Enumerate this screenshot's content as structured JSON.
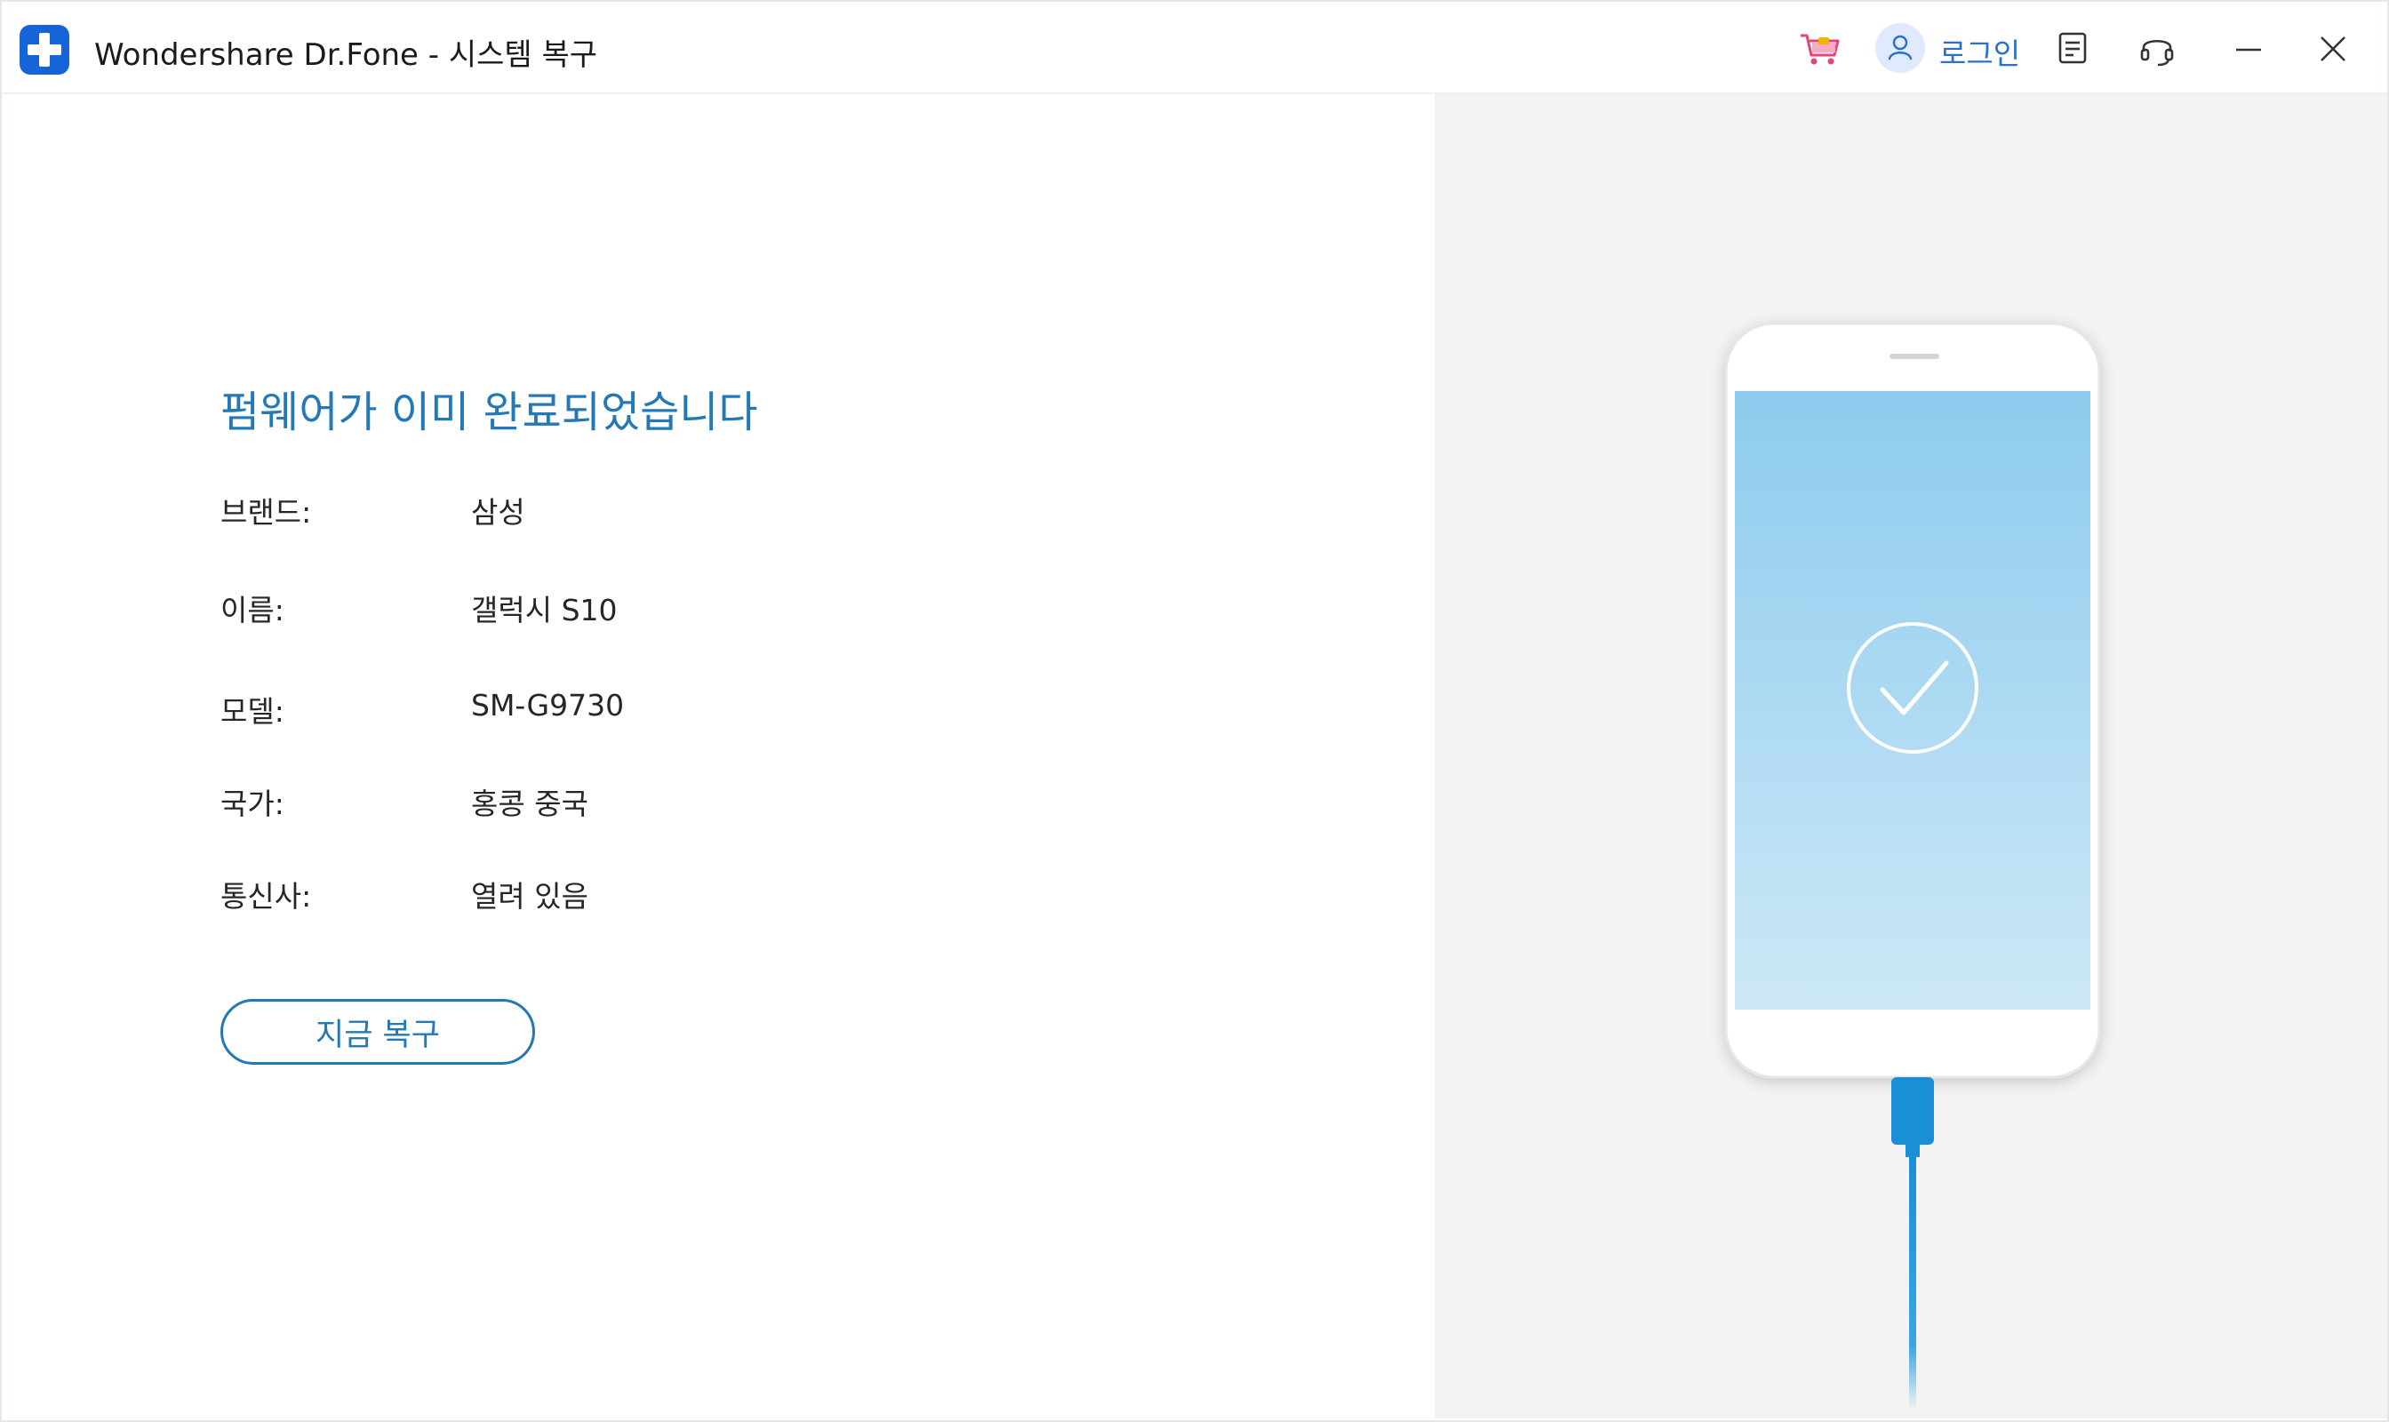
{
  "window": {
    "title": "Wondershare Dr.Fone - 시스템 복구",
    "logo_icon": "drfone-plus-icon",
    "accent_color": "#1565d8"
  },
  "toolbar": {
    "cart_icon": "shopping-cart-icon",
    "login_label": "로그인",
    "user_icon": "user-icon",
    "feedback_icon": "notes-icon",
    "support_icon": "headset-icon",
    "minimize_icon": "minimize-icon",
    "close_icon": "close-icon"
  },
  "main": {
    "headline": "펌웨어가 이미 완료되었습니다",
    "headline_color": "#2379b6",
    "device_info": [
      {
        "label": "브랜드:",
        "value": "삼성"
      },
      {
        "label": "이름:",
        "value": "갤럭시 S10"
      },
      {
        "label": "모델:",
        "value": "SM-G9730"
      },
      {
        "label": "국가:",
        "value": "홍콩 중국"
      },
      {
        "label": "통신사:",
        "value": "열려 있음"
      }
    ],
    "repair_button_label": "지금 복구"
  },
  "illustration": {
    "phone_icon": "phone-connected-icon",
    "status_icon": "checkmark-circle-icon",
    "screen_color": "#8fcbed",
    "cable_color": "#1a8fd6"
  }
}
